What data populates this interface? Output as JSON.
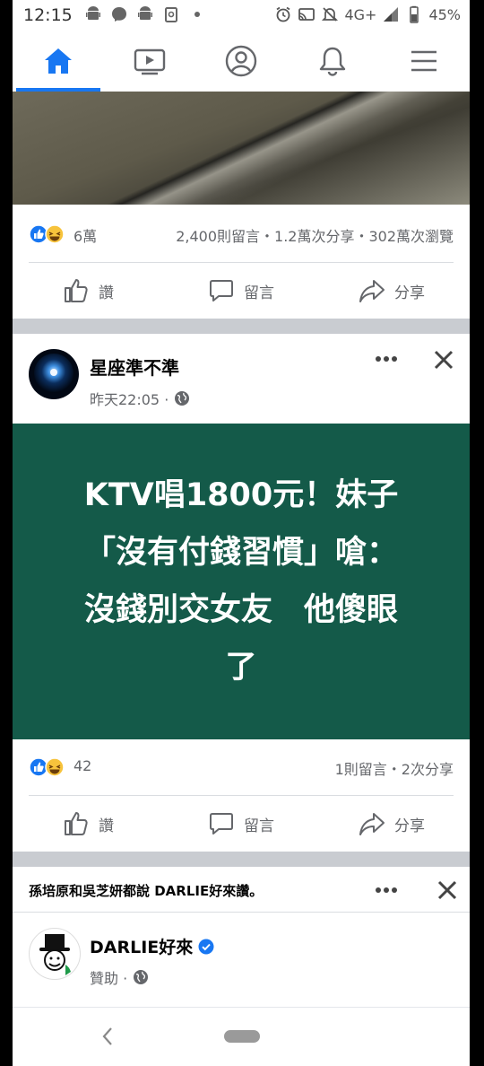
{
  "status_bar": {
    "time": "12:15",
    "network": "4G+",
    "battery": "45%",
    "left_icons": [
      "android-icon",
      "messenger-icon",
      "android-icon",
      "clipboard-icon",
      "dot-icon"
    ],
    "right_icons": [
      "alarm-icon",
      "cast-icon",
      "mute-icon",
      "signal-icon",
      "battery-icon"
    ]
  },
  "nav": {
    "tabs": [
      {
        "id": "home",
        "icon": "home-icon",
        "active": true
      },
      {
        "id": "watch",
        "icon": "video-icon",
        "active": false
      },
      {
        "id": "profile",
        "icon": "profile-icon",
        "active": false
      },
      {
        "id": "notifications",
        "icon": "bell-icon",
        "active": false
      },
      {
        "id": "menu",
        "icon": "menu-icon",
        "active": false
      }
    ],
    "accent": "#1877f2"
  },
  "post1": {
    "reaction_count": "6萬",
    "stats": "2,400則留言・1.2萬次分享・302萬次瀏覽"
  },
  "actions": {
    "like": "讚",
    "comment": "留言",
    "share": "分享"
  },
  "post2": {
    "page_name": "星座準不準",
    "time": "昨天22:05 ·",
    "image_text": "KTV唱1800元！妹子\n「沒有付錢習慣」嗆：\n沒錢別交女友　他傻眼\n了",
    "image_bg": "#145a49",
    "reaction_count": "42",
    "stats": "1則留言・2次分享"
  },
  "post3": {
    "social_context": "孫培原和吳芝妍都說 DARLIE好來讚。",
    "page_name": "DARLIE好來",
    "meta": "贊助 ·"
  }
}
